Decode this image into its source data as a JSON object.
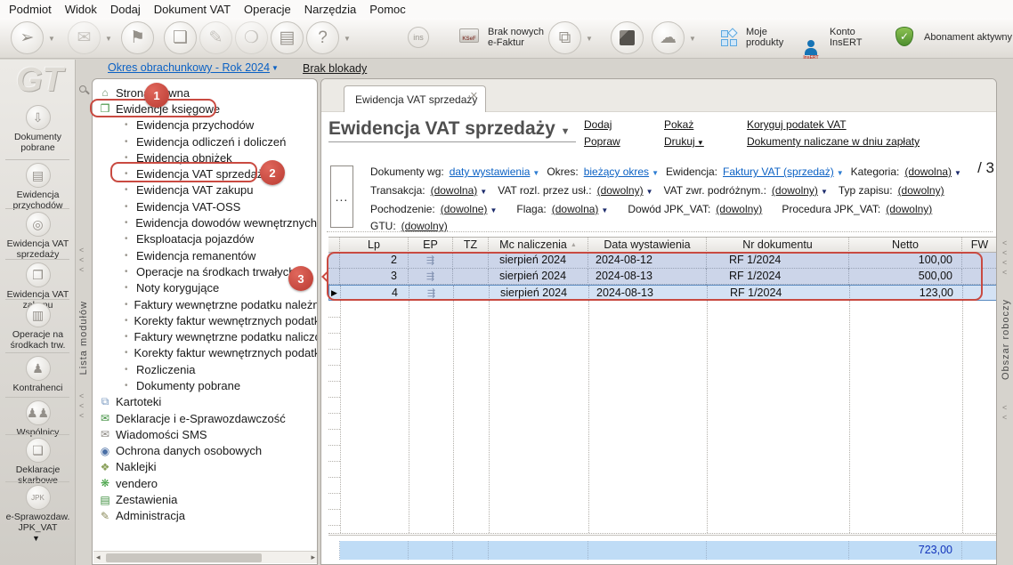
{
  "menubar": {
    "items": [
      "Podmiot",
      "Widok",
      "Dodaj",
      "Dokument VAT",
      "Operacje",
      "Narzędzia",
      "Pomoc"
    ]
  },
  "toolbar": {
    "buttons": [
      {
        "name": "nawigacja",
        "glyph": "➢",
        "caret": true,
        "disabled": false
      },
      {
        "name": "wyslij",
        "glyph": "✉",
        "caret": true,
        "disabled": true
      },
      {
        "name": "flaga",
        "glyph": "⚑",
        "caret": false,
        "disabled": false
      },
      {
        "name": "nowy-dokument",
        "glyph": "❏",
        "caret": false,
        "disabled": false
      },
      {
        "name": "edycja",
        "glyph": "✎",
        "caret": false,
        "disabled": true
      },
      {
        "name": "stempel",
        "glyph": "❍",
        "caret": false,
        "disabled": true
      },
      {
        "name": "drukarka",
        "glyph": "▤",
        "caret": false,
        "disabled": false
      },
      {
        "name": "pomoc",
        "glyph": "?",
        "caret": true,
        "disabled": false
      }
    ],
    "ins_label": "ins",
    "ksef_label": "KSeF",
    "ksef_text": "Brak nowych\ne-Faktur",
    "moje_produkty": "Moje\nprodukty",
    "konto": "Konto\nInsERT",
    "abonament": "Abonament aktywny"
  },
  "sidebar": {
    "modules": [
      {
        "label": "Dokumenty pobrane",
        "icon": "inbox",
        "glyph": "⇩"
      },
      {
        "label": "Ewidencja przychodów",
        "icon": "income",
        "glyph": "▤"
      },
      {
        "label": "Ewidencja VAT sprzedaży",
        "icon": "vat-sales",
        "glyph": "◎"
      },
      {
        "label": "Ewidencja VAT zakupu",
        "icon": "vat-purchase",
        "glyph": "❐"
      },
      {
        "label": "Operacje na środkach trw.",
        "icon": "fixed-assets",
        "glyph": "▥"
      },
      {
        "label": "Kontrahenci",
        "icon": "contractors",
        "glyph": "♟"
      },
      {
        "label": "Wspólnicy",
        "icon": "partners",
        "glyph": "♟♟"
      },
      {
        "label": "Deklaracje skarbowe",
        "icon": "declarations",
        "glyph": "❏"
      },
      {
        "label": "e-Sprawozdaw. JPK_VAT",
        "icon": "jpk",
        "glyph": "JPK"
      }
    ]
  },
  "strips": {
    "left_label": "Lista modułów",
    "right_label": "Obszar roboczy"
  },
  "header": {
    "period_link": "Okres obrachunkowy - Rok 2024",
    "lock_link": "Brak blokady"
  },
  "tree": {
    "items": [
      {
        "label": "Strona główna",
        "level": 0,
        "icon": "home",
        "glyph": "⌂",
        "color": "#6a8f6a"
      },
      {
        "label": "Ewidencje księgowe",
        "level": 0,
        "icon": "ledger-book",
        "glyph": "❒",
        "color": "#3f8f3f"
      },
      {
        "label": "Ewidencja przychodów",
        "level": 1
      },
      {
        "label": "Ewidencja odliczeń i doliczeń",
        "level": 1
      },
      {
        "label": "Ewidencja obniżek",
        "level": 1
      },
      {
        "label": "Ewidencja VAT sprzedaży",
        "level": 1
      },
      {
        "label": "Ewidencja VAT zakupu",
        "level": 1
      },
      {
        "label": "Ewidencja VAT-OSS",
        "level": 1
      },
      {
        "label": "Ewidencja dowodów wewnętrznych",
        "level": 1
      },
      {
        "label": "Eksploatacja pojazdów",
        "level": 1
      },
      {
        "label": "Ewidencja remanentów",
        "level": 1
      },
      {
        "label": "Operacje na środkach trwałych",
        "level": 1
      },
      {
        "label": "Noty korygujące",
        "level": 1
      },
      {
        "label": "Faktury wewnętrzne podatku należnego",
        "level": 1
      },
      {
        "label": "Korekty faktur wewnętrznych podatku",
        "level": 1
      },
      {
        "label": "Faktury wewnętrzne podatku naliczonego",
        "level": 1
      },
      {
        "label": "Korekty faktur wewnętrznych podatku",
        "level": 1
      },
      {
        "label": "Rozliczenia",
        "level": 1
      },
      {
        "label": "Dokumenty pobrane",
        "level": 1
      },
      {
        "label": "Kartoteki",
        "level": 0,
        "icon": "card-files",
        "glyph": "⧉",
        "color": "#7a9ac0"
      },
      {
        "label": "Deklaracje i e-Sprawozdawczość",
        "level": 0,
        "icon": "declarations",
        "glyph": "✉",
        "color": "#3f8f3f"
      },
      {
        "label": "Wiadomości SMS",
        "level": 0,
        "icon": "sms",
        "glyph": "✉",
        "color": "#8a8680"
      },
      {
        "label": "Ochrona danych osobowych",
        "level": 0,
        "icon": "data-protection",
        "glyph": "◉",
        "color": "#4a6fa5"
      },
      {
        "label": "Naklejki",
        "level": 0,
        "icon": "stickers",
        "glyph": "❖",
        "color": "#8aa05a"
      },
      {
        "label": "vendero",
        "level": 0,
        "icon": "vendero",
        "glyph": "❋",
        "color": "#3f9f3f"
      },
      {
        "label": "Zestawienia",
        "level": 0,
        "icon": "reports",
        "glyph": "▤",
        "color": "#3f8f3f"
      },
      {
        "label": "Administracja",
        "level": 0,
        "icon": "administration",
        "glyph": "✎",
        "color": "#8a8a5a"
      }
    ]
  },
  "tab": {
    "label": "Ewidencja VAT sprzedaży"
  },
  "page": {
    "title": "Ewidencja VAT sprzedaży"
  },
  "actions": {
    "columns": [
      [
        {
          "label": "Dodaj"
        },
        {
          "label": "Popraw"
        }
      ],
      [
        {
          "label": "Pokaż"
        },
        {
          "label": "Drukuj",
          "caret": true
        }
      ],
      [
        {
          "label": "Koryguj podatek VAT"
        },
        {
          "label": "Dokumenty naliczane w dniu zapłaty"
        }
      ]
    ]
  },
  "filters": {
    "more_button": "...",
    "record_count": "/ 3",
    "rows": [
      [
        {
          "label": "Dokumenty wg:",
          "value": "daty wystawienia",
          "blue": true,
          "caret": true
        },
        {
          "label": "Okres:",
          "value": "bieżący okres",
          "blue": true,
          "caret": true
        },
        {
          "label": "Ewidencja:",
          "value": "Faktury VAT (sprzedaż)",
          "blue": true,
          "caret": true
        },
        {
          "label": "Kategoria:",
          "value": "(dowolna)",
          "blue": false,
          "caret": true
        }
      ],
      [
        {
          "label": "Transakcja:",
          "value": "(dowolna)",
          "blue": false,
          "caret": true
        },
        {
          "label": "VAT rozl. przez usł.:",
          "value": "(dowolny)",
          "blue": false,
          "caret": true
        },
        {
          "label": "VAT zwr. podróżnym.:",
          "value": "(dowolny)",
          "blue": false,
          "caret": true
        },
        {
          "label": "Typ zapisu:",
          "value": "(dowolny)",
          "blue": false,
          "caret": false
        }
      ],
      [
        {
          "label": "Pochodzenie:",
          "value": "(dowolne)",
          "blue": false,
          "caret": true
        },
        {
          "label": "Flaga:",
          "value": "(dowolna)",
          "blue": false,
          "caret": true
        },
        {
          "label": "Dowód JPK_VAT:",
          "value": "(dowolny)",
          "blue": false,
          "caret": false
        },
        {
          "label": "Procedura JPK_VAT:",
          "value": "(dowolny)",
          "blue": false,
          "caret": false
        }
      ],
      [
        {
          "label": "GTU:",
          "value": "(dowolny)",
          "blue": false,
          "caret": false
        }
      ]
    ]
  },
  "table": {
    "columns": [
      {
        "key": "marker",
        "label": ""
      },
      {
        "key": "lp",
        "label": "Lp"
      },
      {
        "key": "ep",
        "label": "EP"
      },
      {
        "key": "tz",
        "label": "TZ"
      },
      {
        "key": "mc",
        "label": "Mc naliczenia",
        "sort": true
      },
      {
        "key": "data",
        "label": "Data wystawienia"
      },
      {
        "key": "nr",
        "label": "Nr dokumentu"
      },
      {
        "key": "netto",
        "label": "Netto"
      },
      {
        "key": "fw",
        "label": "FW"
      }
    ],
    "rows": [
      {
        "lp": "2",
        "ep": true,
        "tz": "",
        "mc": "sierpień 2024",
        "data": "2024-08-12",
        "nr": "RF 1/2024",
        "netto": "100,00",
        "fw": "",
        "current": false
      },
      {
        "lp": "3",
        "ep": true,
        "tz": "",
        "mc": "sierpień 2024",
        "data": "2024-08-13",
        "nr": "RF 1/2024",
        "netto": "500,00",
        "fw": "",
        "current": false
      },
      {
        "lp": "4",
        "ep": true,
        "tz": "",
        "mc": "sierpień 2024",
        "data": "2024-08-13",
        "nr": "RF 1/2024",
        "netto": "123,00",
        "fw": "",
        "current": true
      }
    ],
    "total_netto": "723,00"
  },
  "annotations": {
    "step1": "1",
    "step2": "2",
    "step3": "3"
  }
}
